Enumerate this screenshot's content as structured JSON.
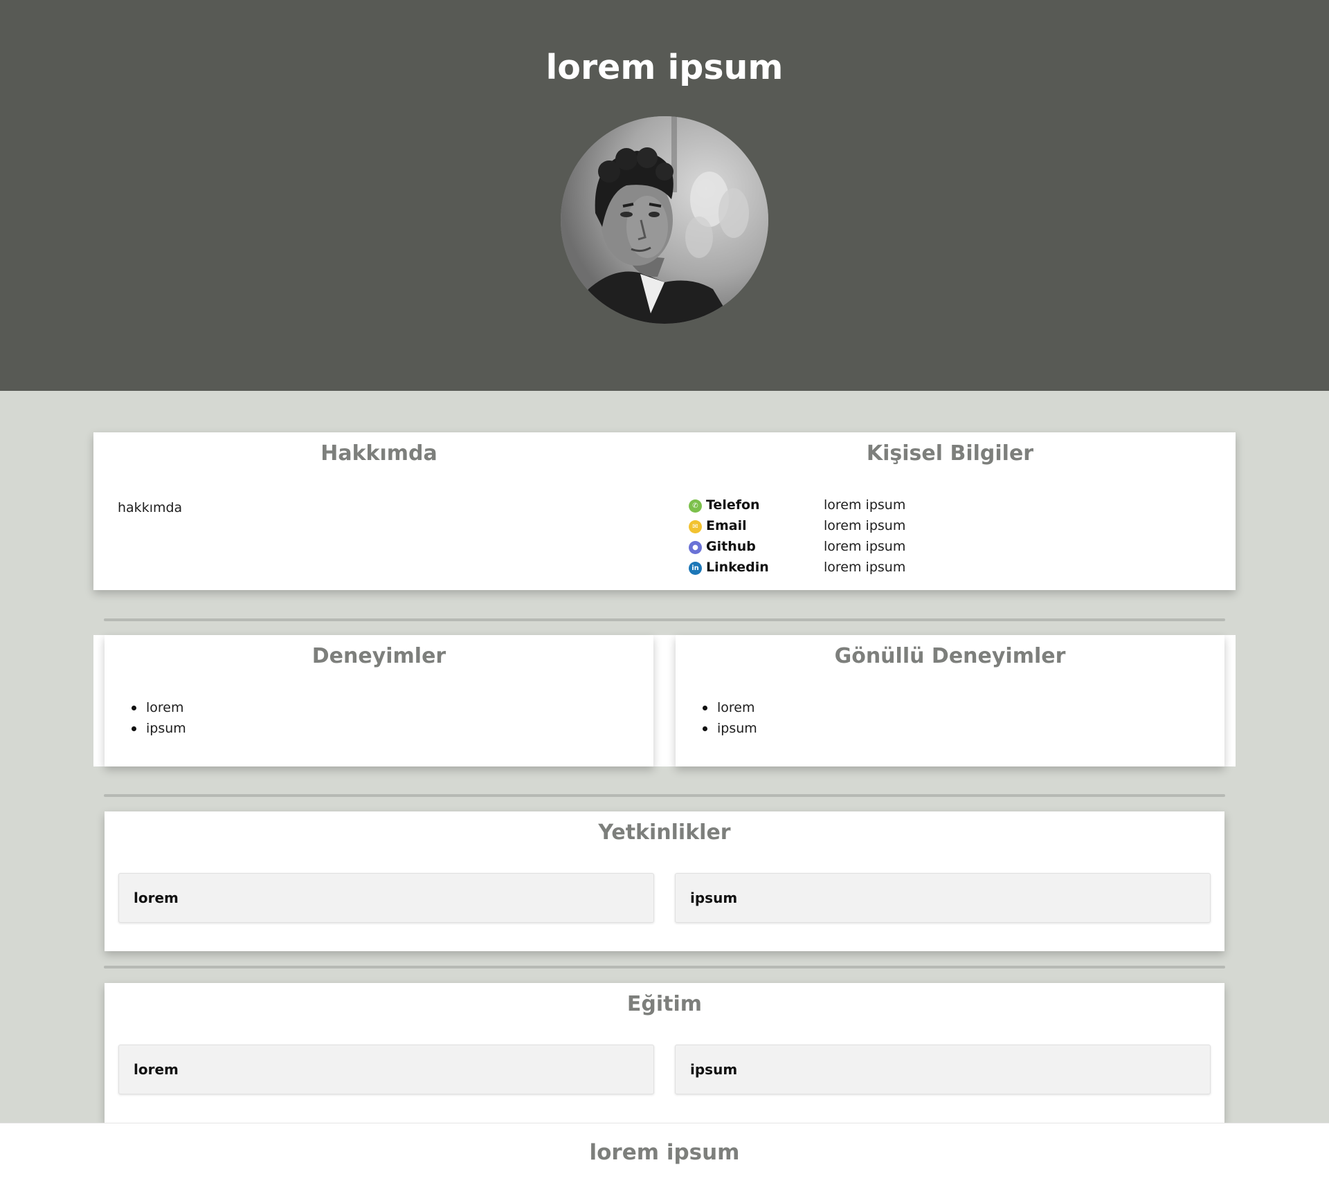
{
  "header": {
    "title": "lorem ipsum"
  },
  "about": {
    "title": "Hakkımda",
    "text": "hakkımda"
  },
  "personal": {
    "title": "Kişisel Bilgiler",
    "items": [
      {
        "label": "Telefon",
        "value": "lorem ipsum",
        "icon": "phone-icon",
        "color": "#7cc04b"
      },
      {
        "label": "Email",
        "value": "lorem ipsum",
        "icon": "mail-icon",
        "color": "#f2c230"
      },
      {
        "label": "Github",
        "value": "lorem ipsum",
        "icon": "github-icon",
        "color": "#6a72d6"
      },
      {
        "label": "Linkedin",
        "value": "lorem ipsum",
        "icon": "linkedin-icon",
        "color": "#1c77b7"
      }
    ]
  },
  "experience": {
    "title": "Deneyimler",
    "items": [
      "lorem",
      "ipsum"
    ]
  },
  "volunteer": {
    "title": "Gönüllü Deneyimler",
    "items": [
      "lorem",
      "ipsum"
    ]
  },
  "skills": {
    "title": "Yetkinlikler",
    "items": [
      "lorem",
      "ipsum"
    ]
  },
  "education": {
    "title": "Eğitim",
    "items": [
      "lorem",
      "ipsum"
    ]
  },
  "footer": {
    "text": "lorem ipsum"
  },
  "colors": {
    "header_bg": "#585a55",
    "page_bg": "#d5d8d2",
    "title_gray": "#7d7f7c"
  }
}
